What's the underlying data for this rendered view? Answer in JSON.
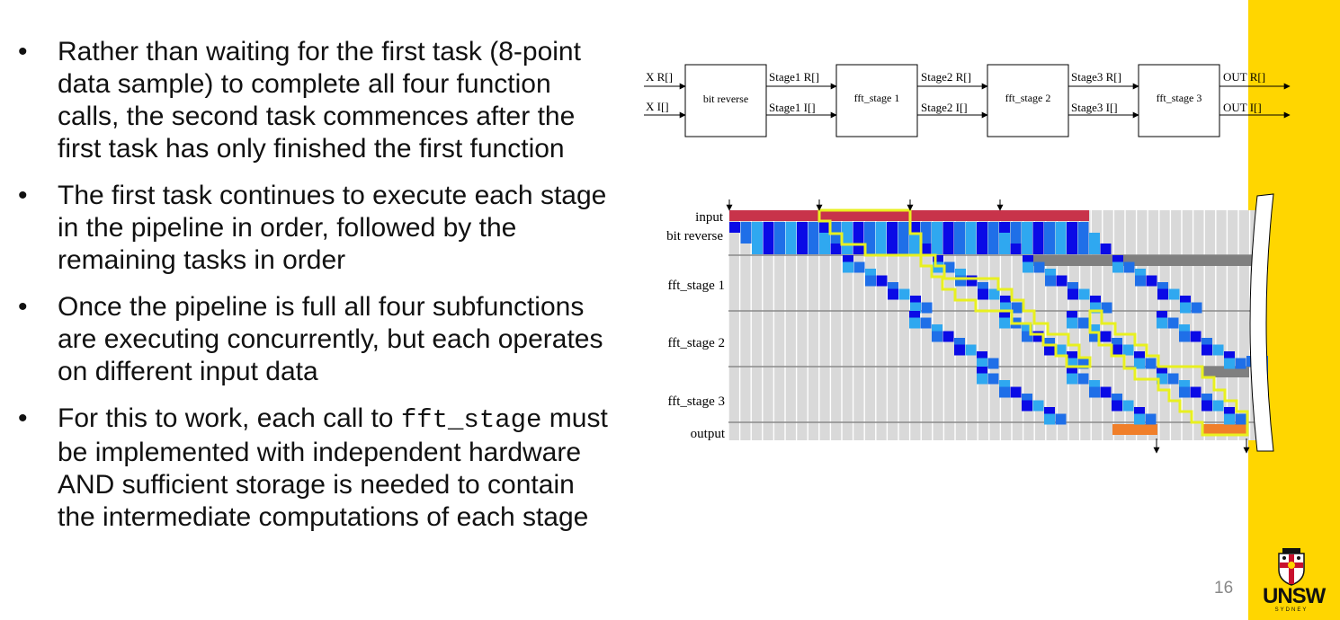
{
  "slide": {
    "bullets": [
      {
        "text": "Rather than waiting for the first task (8-point data sample) to complete all four function calls, the second task commences after the first task has only finished the first function"
      },
      {
        "text": "The first task continues to execute each stage in the pipeline in order, followed by the remaining tasks in order"
      },
      {
        "text": "Once the pipeline is full all four subfunctions are executing concurrently, but each operates on different input data"
      },
      {
        "text_before": "For this to work, each call to ",
        "code": "fft_stage",
        "text_after": " must be implemented with independent hardware AND sufficient storage is needed to contain the intermediate computations of each stage"
      }
    ],
    "page_number": "16"
  },
  "dataflow": {
    "inputs": [
      "X R[]",
      "X I[]"
    ],
    "blocks": [
      "bit reverse",
      "fft_stage 1",
      "fft_stage 2",
      "fft_stage 3"
    ],
    "links": [
      {
        "top": "Stage1 R[]",
        "bottom": "Stage1 I[]"
      },
      {
        "top": "Stage2 R[]",
        "bottom": "Stage2 I[]"
      },
      {
        "top": "Stage3 R[]",
        "bottom": "Stage3 I[]"
      }
    ],
    "outputs": [
      "OUT R[]",
      "OUT I[]"
    ]
  },
  "timeline": {
    "row_labels": [
      "input",
      "bit reverse",
      "fft_stage 1",
      "fft_stage 2",
      "fft_stage 3",
      "output"
    ]
  },
  "logo": {
    "name": "UNSW",
    "sub": "SYDNEY"
  },
  "colors": {
    "accent": "#ffd600",
    "input_bar": "#c8334a",
    "task_dark": "#0a0ae6",
    "task_mid": "#1f6fe8",
    "task_light": "#2fa8f0",
    "highlight": "#e8f020",
    "stall": "#808080",
    "output": "#f07f2a"
  }
}
